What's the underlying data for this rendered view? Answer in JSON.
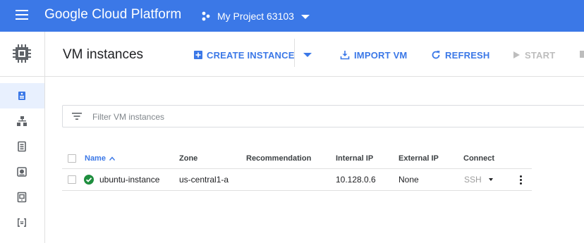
{
  "topbar": {
    "brand": "Google Cloud Platform",
    "project_name": "My Project 63103",
    "icons": [
      "menu-icon",
      "project-icon",
      "chevron-down-icon"
    ],
    "bg_color": "#3b78e7"
  },
  "leftnav": {
    "header_icon": "chip-icon",
    "items": [
      {
        "icon": "vm-instances-icon",
        "active": true
      },
      {
        "icon": "instance-groups-icon",
        "active": false
      },
      {
        "icon": "instance-templates-icon",
        "active": false
      },
      {
        "icon": "disks-icon",
        "active": false
      },
      {
        "icon": "snapshots-icon",
        "active": false
      },
      {
        "icon": "images-icon",
        "active": false
      }
    ]
  },
  "header": {
    "title": "VM instances",
    "create_label": "CREATE INSTANCE",
    "import_label": "IMPORT VM",
    "refresh_label": "REFRESH",
    "start_label": "START",
    "accent_color": "#3b78e7"
  },
  "filter": {
    "placeholder": "Filter VM instances",
    "value": ""
  },
  "table": {
    "columns": [
      "Name",
      "Zone",
      "Recommendation",
      "Internal IP",
      "External IP",
      "Connect"
    ],
    "sort_column": "Name",
    "sort_direction": "ascending",
    "rows": [
      {
        "status": "running",
        "name": "ubuntu-instance",
        "zone": "us-central1-a",
        "recommendation": "",
        "internal_ip": "10.128.0.6",
        "external_ip": "None",
        "connect": "SSH"
      }
    ],
    "status_color": "#1e8e3e"
  }
}
